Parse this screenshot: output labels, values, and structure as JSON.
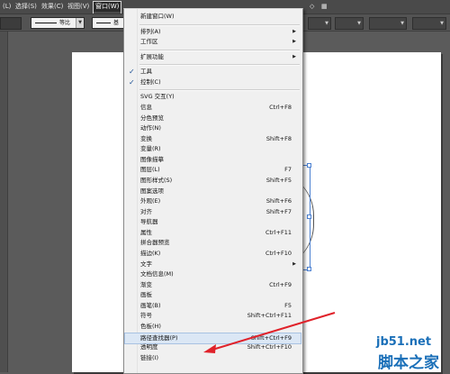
{
  "menubar": {
    "items": [
      "(L)",
      "选择(S)",
      "效果(C)",
      "视图(V)",
      "窗口(W)"
    ],
    "active_index": 4,
    "right_items": [
      "◇",
      "▦"
    ]
  },
  "controlbar": {
    "stroke1_label": "等比",
    "stroke2_label": "基"
  },
  "menu": {
    "items": [
      {
        "label": "新建窗口(W)",
        "shortcut": "",
        "submenu": false,
        "checked": false
      },
      {
        "sep": true
      },
      {
        "label": "排列(A)",
        "shortcut": "",
        "submenu": true,
        "checked": false
      },
      {
        "label": "工作区",
        "shortcut": "",
        "submenu": true,
        "checked": false
      },
      {
        "sep": true
      },
      {
        "label": "扩展功能",
        "shortcut": "",
        "submenu": true,
        "checked": false
      },
      {
        "sep": true
      },
      {
        "label": "工具",
        "shortcut": "",
        "submenu": false,
        "checked": true
      },
      {
        "label": "控制(C)",
        "shortcut": "",
        "submenu": false,
        "checked": true
      },
      {
        "sep": true
      },
      {
        "label": "SVG 交互(Y)",
        "shortcut": "",
        "submenu": false,
        "checked": false
      },
      {
        "label": "信息",
        "shortcut": "Ctrl+F8",
        "submenu": false,
        "checked": false
      },
      {
        "label": "分色预览",
        "shortcut": "",
        "submenu": false,
        "checked": false
      },
      {
        "label": "动作(N)",
        "shortcut": "",
        "submenu": false,
        "checked": false
      },
      {
        "label": "变换",
        "shortcut": "Shift+F8",
        "submenu": false,
        "checked": false
      },
      {
        "label": "变量(R)",
        "shortcut": "",
        "submenu": false,
        "checked": false
      },
      {
        "label": "图像描摹",
        "shortcut": "",
        "submenu": false,
        "checked": false
      },
      {
        "label": "图层(L)",
        "shortcut": "F7",
        "submenu": false,
        "checked": false
      },
      {
        "label": "图形样式(S)",
        "shortcut": "Shift+F5",
        "submenu": false,
        "checked": false
      },
      {
        "label": "图案选项",
        "shortcut": "",
        "submenu": false,
        "checked": false
      },
      {
        "label": "外观(E)",
        "shortcut": "Shift+F6",
        "submenu": false,
        "checked": false
      },
      {
        "label": "对齐",
        "shortcut": "Shift+F7",
        "submenu": false,
        "checked": false
      },
      {
        "label": "导航器",
        "shortcut": "",
        "submenu": false,
        "checked": false
      },
      {
        "label": "属性",
        "shortcut": "Ctrl+F11",
        "submenu": false,
        "checked": false
      },
      {
        "label": "拼合器预览",
        "shortcut": "",
        "submenu": false,
        "checked": false
      },
      {
        "label": "描边(K)",
        "shortcut": "Ctrl+F10",
        "submenu": false,
        "checked": false
      },
      {
        "label": "文字",
        "shortcut": "",
        "submenu": true,
        "checked": false
      },
      {
        "label": "文档信息(M)",
        "shortcut": "",
        "submenu": false,
        "checked": false
      },
      {
        "label": "渐变",
        "shortcut": "Ctrl+F9",
        "submenu": false,
        "checked": false
      },
      {
        "label": "画板",
        "shortcut": "",
        "submenu": false,
        "checked": false
      },
      {
        "label": "画笔(B)",
        "shortcut": "F5",
        "submenu": false,
        "checked": false
      },
      {
        "label": "符号",
        "shortcut": "Shift+Ctrl+F11",
        "submenu": false,
        "checked": false
      },
      {
        "label": "色板(H)",
        "shortcut": "",
        "submenu": false,
        "checked": false
      },
      {
        "label": "路径查找器(P)",
        "shortcut": "Shift+Ctrl+F9",
        "submenu": false,
        "checked": false,
        "highlighted": true
      },
      {
        "label": "透明度",
        "shortcut": "Shift+Ctrl+F10",
        "submenu": false,
        "checked": false
      },
      {
        "label": "链接(I)",
        "shortcut": "",
        "submenu": false,
        "checked": false
      }
    ]
  },
  "watermark": {
    "line1": "jb51.net",
    "line2": "脚本之家"
  },
  "colors": {
    "arrow": "#e0222a",
    "watermark": "#1a6fb8",
    "menu_highlight": "#dbe7f5"
  }
}
